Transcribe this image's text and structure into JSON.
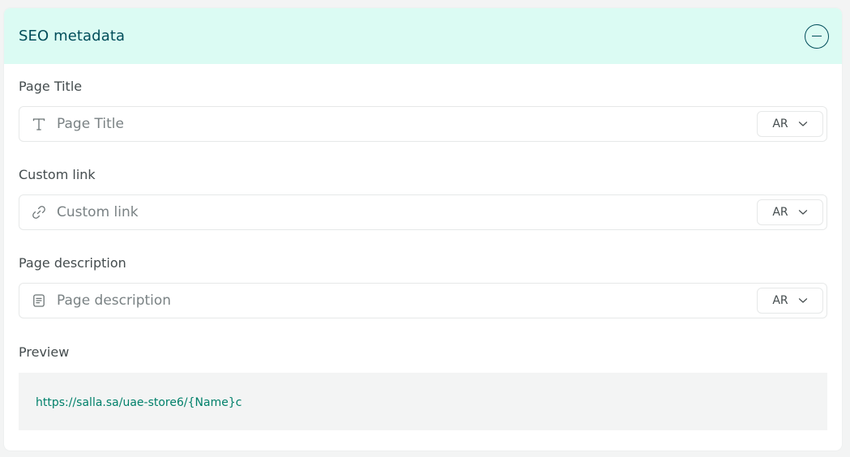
{
  "section": {
    "title": "SEO metadata",
    "collapse_icon": "minus-circle-icon"
  },
  "fields": [
    {
      "label": "Page Title",
      "placeholder": "Page Title",
      "value": "",
      "icon": "text-type-icon",
      "language": "AR"
    },
    {
      "label": "Custom link",
      "placeholder": "Custom link",
      "value": "",
      "icon": "link-icon",
      "language": "AR"
    },
    {
      "label": "Page description",
      "placeholder": "Page description",
      "value": "",
      "icon": "document-icon",
      "language": "AR"
    }
  ],
  "preview": {
    "label": "Preview",
    "url": "https://salla.sa/uae-store6/{Name}c"
  },
  "colors": {
    "header_bg": "#dbfbf3",
    "header_text": "#004d5a",
    "link": "#00806a"
  }
}
